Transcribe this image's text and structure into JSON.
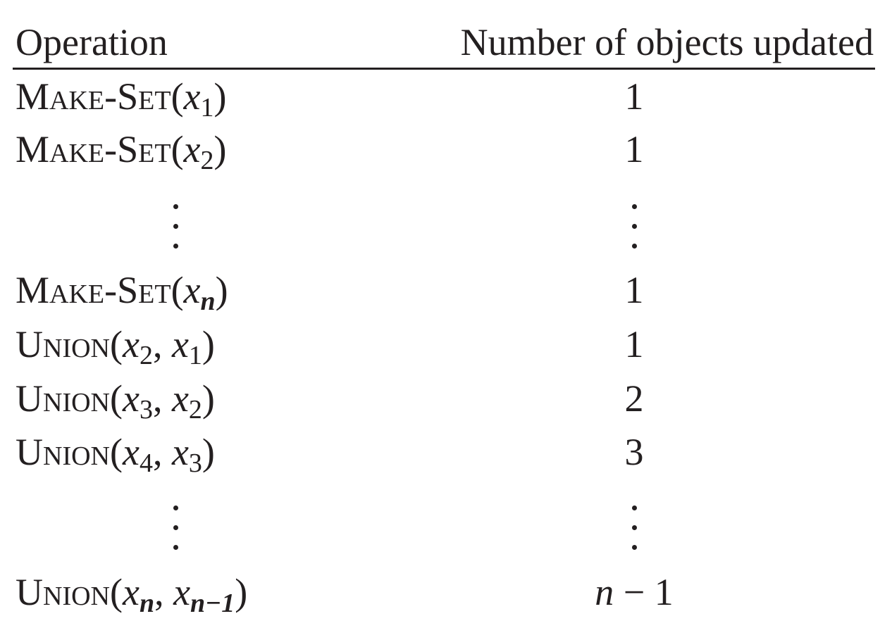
{
  "header": {
    "operation": "Operation",
    "count": "Number of objects updated"
  },
  "rows": [
    {
      "name": "Make-Set",
      "open": "(",
      "var1": "x",
      "sub1": "1",
      "close": ")",
      "count": "1"
    },
    {
      "name": "Make-Set",
      "open": "(",
      "var1": "x",
      "sub1": "2",
      "close": ")",
      "count": "1"
    },
    {
      "name": "Make-Set",
      "open": "(",
      "var1": "x",
      "sub1": "n",
      "close": ")",
      "count": "1"
    },
    {
      "name": "Union",
      "open": "(",
      "var1": "x",
      "sub1": "2",
      "sep": ", ",
      "var2": "x",
      "sub2": "1",
      "close": ")",
      "count": "1"
    },
    {
      "name": "Union",
      "open": "(",
      "var1": "x",
      "sub1": "3",
      "sep": ", ",
      "var2": "x",
      "sub2": "2",
      "close": ")",
      "count": "2"
    },
    {
      "name": "Union",
      "open": "(",
      "var1": "x",
      "sub1": "4",
      "sep": ", ",
      "var2": "x",
      "sub2": "3",
      "close": ")",
      "count": "3"
    },
    {
      "name": "Union",
      "open": "(",
      "var1": "x",
      "sub1": "n",
      "sep": ", ",
      "var2": "x",
      "sub2": "n−1",
      "close": ")",
      "count_var": "n",
      "count_rest": " − 1"
    }
  ]
}
